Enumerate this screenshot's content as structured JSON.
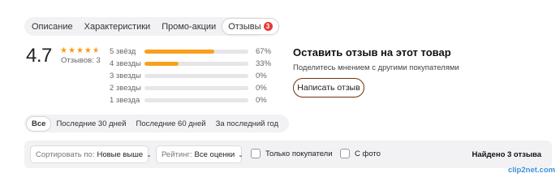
{
  "tabs": [
    {
      "label": "Описание"
    },
    {
      "label": "Характеристики"
    },
    {
      "label": "Промо-акции"
    },
    {
      "label": "Отзывы",
      "badge": "3"
    }
  ],
  "rating": {
    "value": "4.7",
    "stars": 4.7,
    "reviews_label": "Отзывов: 3"
  },
  "breakdown": [
    {
      "label": "5 звёзд",
      "percent_text": "67%",
      "fraction": 0.67
    },
    {
      "label": "4 звезды",
      "percent_text": "33%",
      "fraction": 0.33
    },
    {
      "label": "3 звезды",
      "percent_text": "0%",
      "fraction": 0
    },
    {
      "label": "2 звезды",
      "percent_text": "0%",
      "fraction": 0
    },
    {
      "label": "1 звезда",
      "percent_text": "0%",
      "fraction": 0
    }
  ],
  "cta": {
    "title": "Оставить отзыв на этот товар",
    "subtitle": "Поделитесь мнением с другими покупателями",
    "button": "Написать отзыв"
  },
  "periods": [
    {
      "label": "Все"
    },
    {
      "label": "Последние 30 дней"
    },
    {
      "label": "Последние 60 дней"
    },
    {
      "label": "За последний год"
    }
  ],
  "filters": {
    "sort_label": "Сортировать по:",
    "sort_value": "Новые выше",
    "rating_label": "Рейтинг:",
    "rating_value": "Все оценки",
    "buyers_only": "Только покупатели",
    "with_photo": "С фото",
    "found": "Найдено 3 отзыва"
  },
  "watermark": "clip2net.com",
  "colors": {
    "accent": "#f7a01d",
    "button_border": "#6b3410",
    "badge": "#e53935"
  }
}
